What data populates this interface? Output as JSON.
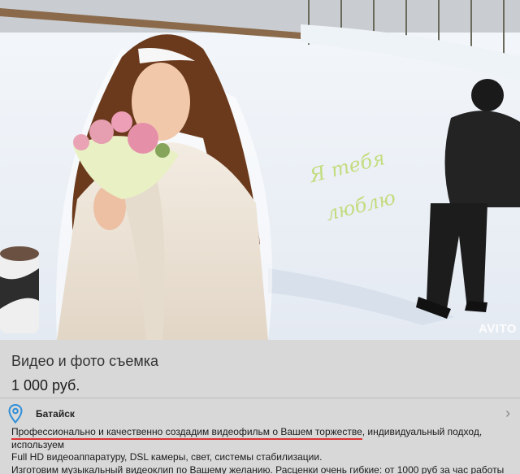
{
  "listing": {
    "title": "Видео и фото съемка",
    "price": "1 000 руб.",
    "location": "Батайск",
    "description_highlight": "Профессионально и качественно создадим видеофильм о Вашем торжестве",
    "description_rest_1": ", индивидуальный подход, используем",
    "description_line_2": "Full HD видеоаппаратуру, DSL камеры, свет, системы стабилизации.",
    "description_line_3": "Изготовим музыкальный видеоклип по Вашему желанию. Расценки очень гибкие: от 1000 руб за час работы"
  },
  "photo": {
    "watermark": "AVITO",
    "snow_text_line1": "Я тебя",
    "snow_text_line2": "люблю"
  },
  "icons": {
    "location": "map-pin-icon",
    "chevron": "chevron-right-icon"
  },
  "colors": {
    "panel_bg": "#d8d8d8",
    "highlight_underline": "#dd3333",
    "pin": "#2f8fd8"
  }
}
